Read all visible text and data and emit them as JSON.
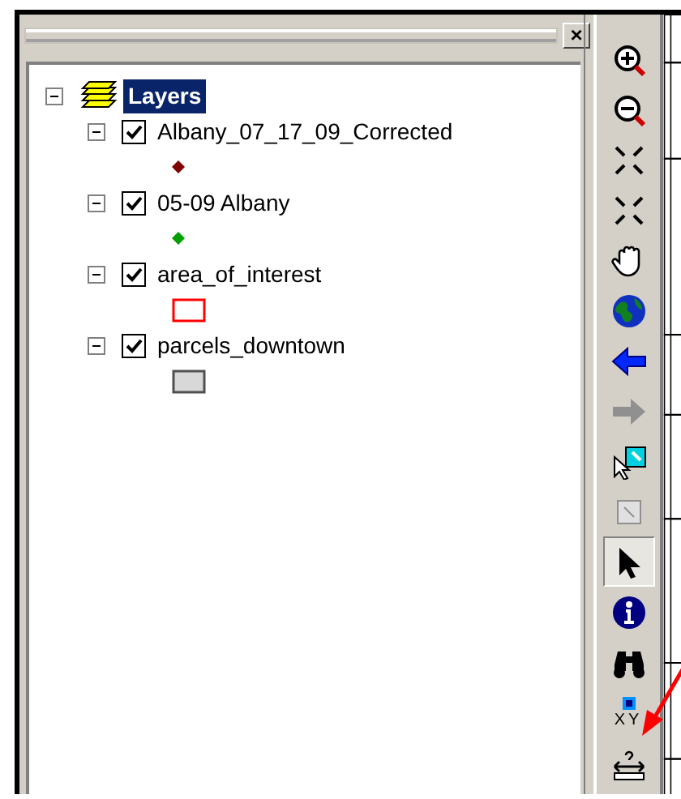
{
  "toc": {
    "close": "×",
    "root": {
      "label": "Layers",
      "selected": true,
      "expanded": true,
      "children": [
        {
          "label": "Albany_07_17_09_Corrected",
          "checked": true,
          "expanded": true,
          "symbol": {
            "kind": "point",
            "color": "#800000"
          }
        },
        {
          "label": "05-09 Albany",
          "checked": true,
          "expanded": true,
          "symbol": {
            "kind": "point",
            "color": "#00a000"
          }
        },
        {
          "label": "area_of_interest",
          "checked": true,
          "expanded": true,
          "symbol": {
            "kind": "hollow-polygon",
            "color": "#ff0000"
          }
        },
        {
          "label": "parcels_downtown",
          "checked": true,
          "expanded": true,
          "symbol": {
            "kind": "filled-polygon",
            "color": "#505050"
          }
        }
      ]
    }
  },
  "tools": [
    {
      "kind": "zoom-in",
      "selected": false,
      "disabled": false
    },
    {
      "kind": "zoom-out",
      "selected": false,
      "disabled": false
    },
    {
      "kind": "fixed-zoom-in",
      "selected": false,
      "disabled": false
    },
    {
      "kind": "fixed-zoom-out",
      "selected": false,
      "disabled": false
    },
    {
      "kind": "pan",
      "selected": false,
      "disabled": false
    },
    {
      "kind": "full-extent",
      "selected": false,
      "disabled": false
    },
    {
      "kind": "back",
      "selected": false,
      "disabled": false
    },
    {
      "kind": "forward",
      "selected": false,
      "disabled": true
    },
    {
      "kind": "select-features",
      "selected": false,
      "disabled": false
    },
    {
      "kind": "clear-selection",
      "selected": false,
      "disabled": true
    },
    {
      "kind": "select-elements",
      "selected": true,
      "disabled": false
    },
    {
      "kind": "identify",
      "selected": false,
      "disabled": false
    },
    {
      "kind": "find",
      "selected": false,
      "disabled": false
    },
    {
      "kind": "xy",
      "label": "XY",
      "selected": false,
      "disabled": false
    },
    {
      "kind": "measure",
      "selected": false,
      "disabled": false
    }
  ]
}
